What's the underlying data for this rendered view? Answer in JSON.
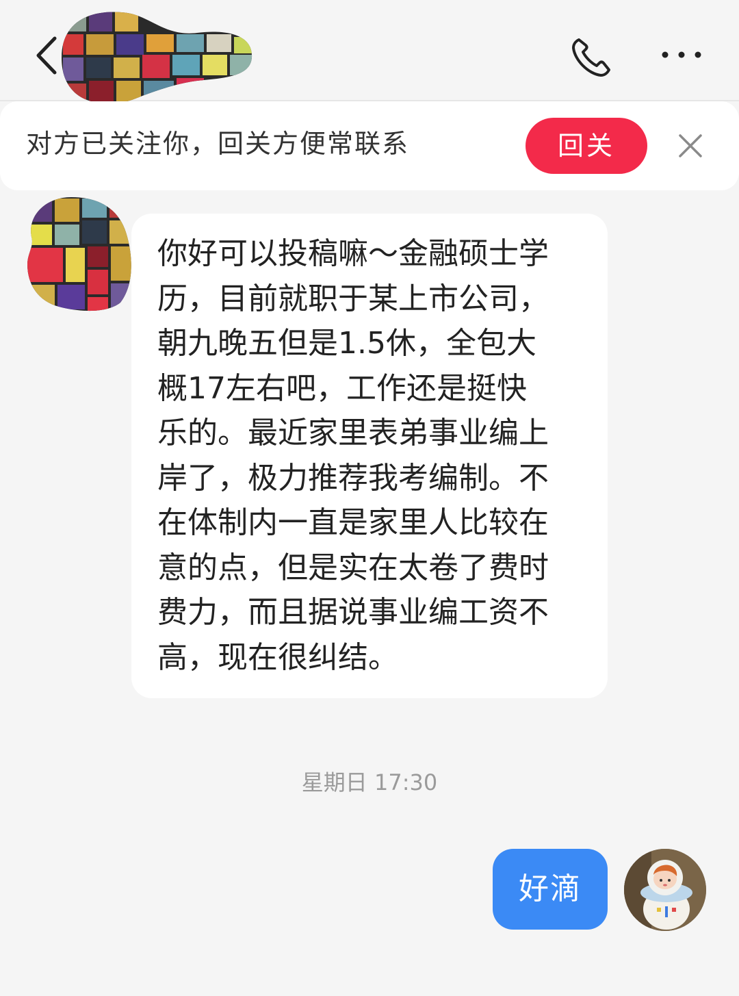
{
  "header": {
    "back_icon": "chevron-left-icon",
    "call_icon": "phone-icon",
    "more_icon": "ellipsis-icon"
  },
  "banner": {
    "text": "对方已关注你，回关方便常联系",
    "follow_label": "回关",
    "close_icon": "close-icon",
    "accent": "#f32a4a"
  },
  "messages": {
    "incoming": {
      "lines": [
        "你好可以投稿嘛～金融硕士学",
        "历，目前就职于某上市公司，",
        "朝九晚五但是1.5休，全包大",
        "概17左右吧，工作还是挺快",
        "乐的。最近家里表弟事业编上",
        "岸了，极力推荐我考编制。不",
        "在体制内一直是家里人比较在",
        "意的点，但是实在太卷了费时",
        "费力，而且据说事业编工资不",
        "高，现在很纠结。"
      ]
    },
    "timestamp": "星期日 17:30",
    "outgoing": {
      "text": "好滴",
      "color": "#3b8af5"
    }
  }
}
